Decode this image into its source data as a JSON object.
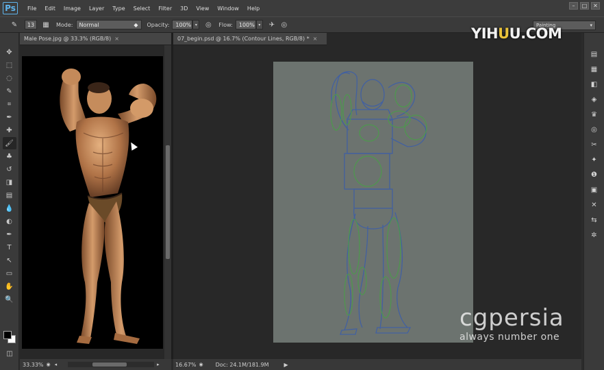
{
  "app": {
    "logo": "Ps"
  },
  "menu": [
    "File",
    "Edit",
    "Image",
    "Layer",
    "Type",
    "Select",
    "Filter",
    "3D",
    "View",
    "Window",
    "Help"
  ],
  "window_controls": [
    "–",
    "□",
    "✕"
  ],
  "options": {
    "brush_size": "13",
    "mode_label": "Mode:",
    "mode_value": "Normal",
    "opacity_label": "Opacity:",
    "opacity_value": "100%",
    "flow_label": "Flow:",
    "flow_value": "100%",
    "workspace": "Painting"
  },
  "tools": [
    "move-icon",
    "marquee-icon",
    "lasso-icon",
    "quick-select-icon",
    "crop-icon",
    "eyedropper-icon",
    "healing-icon",
    "brush-icon",
    "stamp-icon",
    "history-brush-icon",
    "eraser-icon",
    "gradient-icon",
    "blur-icon",
    "dodge-icon",
    "pen-icon",
    "type-icon",
    "path-select-icon",
    "shape-icon",
    "hand-icon",
    "zoom-icon"
  ],
  "tool_glyphs": [
    "✥",
    "⬚",
    "◌",
    "✎",
    "⌗",
    "✒",
    "✚",
    "🖌",
    "♣",
    "↺",
    "◨",
    "▤",
    "💧",
    "◐",
    "✒",
    "T",
    "↖",
    "▭",
    "✋",
    "🔍"
  ],
  "doc1": {
    "tab": "Male Pose.jpg @ 33.3% (RGB/8)",
    "zoom": "33.33%"
  },
  "doc2": {
    "tab": "07_begin.psd @ 16.7% (Contour Lines, RGB/8) *",
    "zoom": "16.67%",
    "doc_size": "Doc: 24.1M/181.9M"
  },
  "dock_icons": [
    "panel-icon",
    "panel-icon",
    "swatches-icon",
    "layers-icon",
    "brush-presets-icon",
    "adjustments-icon",
    "transform-icon",
    "styles-icon",
    "info-icon",
    "character-icon",
    "tool-presets-icon",
    "paths-icon",
    "settings-icon"
  ],
  "dock_glyphs": [
    "▤",
    "▦",
    "◧",
    "◈",
    "♛",
    "◎",
    "✂",
    "✦",
    "❶",
    "▣",
    "✕",
    "⇆",
    "✲"
  ],
  "watermark_top": {
    "text_a": "YIH",
    "text_b": "U",
    "text_c": "U.COM"
  },
  "watermark_bottom": {
    "brand": "cgpersia",
    "tagline": "always number one"
  },
  "colors": {
    "fg": "#000000",
    "bg": "#ffffff",
    "canvas": "#6c736f",
    "sketch_blue": "#3e5fa6",
    "sketch_green": "#4c9a4c"
  }
}
